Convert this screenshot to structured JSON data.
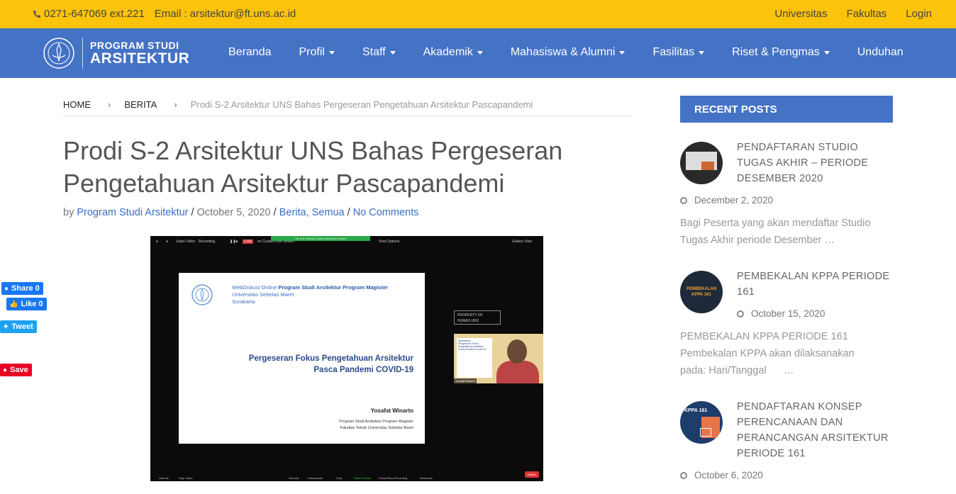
{
  "topbar": {
    "phone": "0271-647069 ext.221",
    "email": "Email : arsitektur@ft.uns.ac.id",
    "links": [
      "Universitas",
      "Fakultas",
      "Login"
    ]
  },
  "logo": {
    "line1": "PROGRAM STUDI",
    "line2": "ARSITEKTUR"
  },
  "nav": {
    "items": [
      {
        "label": "Beranda",
        "dropdown": false
      },
      {
        "label": "Profil",
        "dropdown": true
      },
      {
        "label": "Staff",
        "dropdown": true
      },
      {
        "label": "Akademik",
        "dropdown": true
      },
      {
        "label": "Mahasiswa & Alumni",
        "dropdown": true
      },
      {
        "label": "Fasilitas",
        "dropdown": true
      },
      {
        "label": "Riset & Pengmas",
        "dropdown": true
      },
      {
        "label": "Unduhan",
        "dropdown": false
      }
    ]
  },
  "breadcrumb": {
    "home": "HOME",
    "section": "BERITA",
    "current": "Prodi S-2 Arsitektur UNS Bahas Pergeseran Pengetahuan Arsitektur Pascapandemi",
    "sep": "›"
  },
  "article": {
    "title": "Prodi S-2 Arsitektur UNS Bahas Pergeseran Pengetahuan Arsitektur Pascapandemi",
    "by": "by",
    "author": "Program Studi Arsitektur",
    "date": "October 5, 2020",
    "cat1": "Berita",
    "cat2": "Semua",
    "comments": "No Comments"
  },
  "zoom_image": {
    "top_unmute": "Unpin Video",
    "top_recording": "Recording...",
    "top_live": "LIVE",
    "top_stream": "on Custom Live Stream",
    "viewing_banner": "You are viewing Yosafat Winarto's screen",
    "view_options": "View Options",
    "gallery": "Gallery View",
    "slide_head1": "WebDiskusi Online ",
    "slide_head1b": "Program Studi Arsitektur Program Magister",
    "slide_head2": "Universitas Sebelas Maret",
    "slide_head3": "Surakarta",
    "slide_title1": "Pergeseran Fokus Pengetahuan Arsitektur",
    "slide_title2": "Pasca Pandemi COVID-19",
    "slide_name": "Yosafat Winarto",
    "slide_aff1": "Program Studi Arsitektur Program Magister",
    "slide_aff2": "Fakultas Teknik Universitas Sebelas Maret",
    "property1": "PROPERTY OF",
    "property2": "HUMAS UNS",
    "cam_paper1": "Webdiskusi",
    "cam_paper2": "Pergeseran Fokus",
    "cam_paper3": "Pengetahuan Arsitektur",
    "cam_paper4": "Pasca Pandemi Covid-19",
    "cam_name": "Yosafat Winarto",
    "bottom": [
      "Unmute",
      "Stop Video",
      "Security",
      "Participants",
      "Chat",
      "Share Screen",
      "Pause/Stop Recording",
      "Reactions"
    ],
    "leave": "Leave"
  },
  "share": {
    "fb_share": "Share 0",
    "fb_like": "Like 0",
    "tweet": "Tweet",
    "save": "Save"
  },
  "sidebar": {
    "heading": "RECENT POSTS",
    "posts": [
      {
        "title_lines": [
          "PENDAFTARAN STUDIO",
          "TUGAS AKHIR – PERIODE",
          "DESEMBER 2020"
        ],
        "date": "December 2, 2020",
        "excerpt_lines": [
          "Bagi Peserta yang akan mendaftar Studio",
          "Tugas Akhir periode Desember …"
        ]
      },
      {
        "title_lines": [
          "PEMBEKALAN KPPA PERIODE",
          "161"
        ],
        "date": "October 15, 2020",
        "excerpt_lines": [
          "PEMBEKALAN KPPA PERIODE 161",
          "Pembekalan KPPA akan dilaksanakan",
          "pada: Hari/Tanggal      …"
        ],
        "thumb_text": "PEMBEKALAN KPPA 161"
      },
      {
        "title_lines": [
          "PENDAFTARAN KONSEP",
          "PERENCANAAN DAN",
          "PERANCANGAN ARSITEKTUR",
          "PERIODE 161"
        ],
        "date": "October 6, 2020",
        "thumb_text": "KPPA 161"
      }
    ]
  },
  "colors": {
    "topbar": "#fcc30b",
    "navbar": "#4472c4",
    "link": "#3b6fc2"
  }
}
